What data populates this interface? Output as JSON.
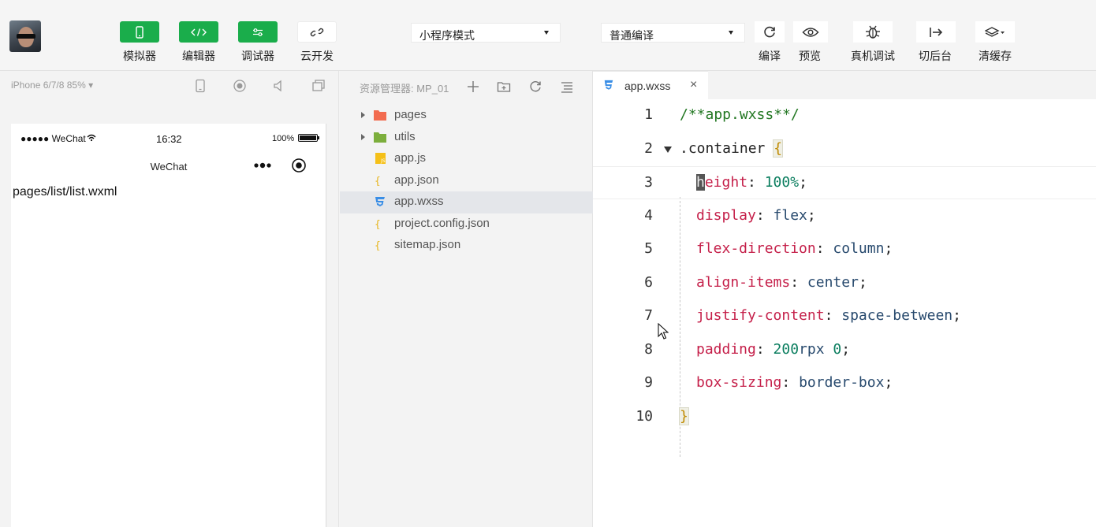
{
  "toolbar": {
    "tools": [
      {
        "label": "模拟器",
        "icon": "phone-icon"
      },
      {
        "label": "编辑器",
        "icon": "code-icon"
      },
      {
        "label": "调试器",
        "icon": "sliders-icon"
      },
      {
        "label": "云开发",
        "icon": "cloud-link-icon"
      }
    ],
    "mode_select": "小程序模式",
    "compile_select": "普通编译",
    "actions": [
      {
        "label": "编译",
        "icon": "refresh-icon"
      },
      {
        "label": "预览",
        "icon": "eye-icon"
      },
      {
        "label": "真机调试",
        "icon": "bug-icon"
      },
      {
        "label": "切后台",
        "icon": "background-arrow-icon"
      },
      {
        "label": "清缓存",
        "icon": "layers-icon"
      }
    ]
  },
  "simulator": {
    "device_label": "iPhone 6/7/8 85% ▾",
    "status_signal": "●●●●● WeChat",
    "status_time": "16:32",
    "status_battery": "100%",
    "nav_title": "WeChat",
    "page_text": "pages/list/list.wxml"
  },
  "explorer": {
    "title": "资源管理器: MP_01",
    "items": [
      {
        "name": "pages",
        "type": "folder",
        "expandable": true,
        "color": "#f26b4f"
      },
      {
        "name": "utils",
        "type": "folder",
        "expandable": true,
        "color": "#7cae3c"
      },
      {
        "name": "app.js",
        "type": "js",
        "expandable": false
      },
      {
        "name": "app.json",
        "type": "json",
        "expandable": false
      },
      {
        "name": "app.wxss",
        "type": "css",
        "expandable": false,
        "selected": true
      },
      {
        "name": "project.config.json",
        "type": "json",
        "expandable": false
      },
      {
        "name": "sitemap.json",
        "type": "json",
        "expandable": false
      }
    ]
  },
  "editor": {
    "tab": {
      "label": "app.wxss",
      "close": "×"
    },
    "lines": [
      {
        "n": "1",
        "comment": "/**app.wxss**/"
      },
      {
        "n": "2",
        "selector": ".container ",
        "brace": "{"
      },
      {
        "n": "3",
        "cursor": "h",
        "prop": "eight",
        "colon": ": ",
        "value": "100%",
        "semi": ";"
      },
      {
        "n": "4",
        "prop": "display",
        "colon": ": ",
        "value": "flex",
        "semi": ";"
      },
      {
        "n": "5",
        "prop": "flex-direction",
        "colon": ": ",
        "value": "column",
        "semi": ";"
      },
      {
        "n": "6",
        "prop": "align-items",
        "colon": ": ",
        "value": "center",
        "semi": ";"
      },
      {
        "n": "7",
        "prop": "justify-content",
        "colon": ": ",
        "value": "space-between",
        "semi": ";"
      },
      {
        "n": "8",
        "prop": "padding",
        "colon": ": ",
        "value_num": "200",
        "value_unit": "rpx ",
        "value_num2": "0",
        "semi": ";"
      },
      {
        "n": "9",
        "prop": "box-sizing",
        "colon": ": ",
        "value": "border-box",
        "semi": ";"
      },
      {
        "n": "10",
        "close_brace": "}"
      }
    ]
  }
}
